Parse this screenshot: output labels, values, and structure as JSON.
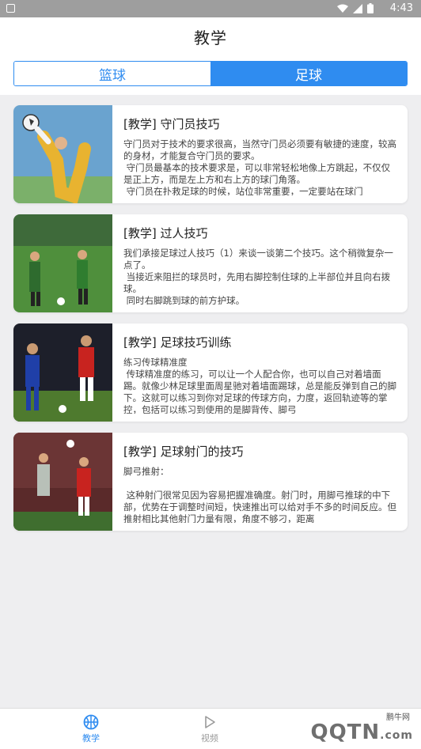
{
  "status_bar": {
    "time": "4:43"
  },
  "header": {
    "title": "教学"
  },
  "tabs": [
    {
      "label": "篮球",
      "active": false
    },
    {
      "label": "足球",
      "active": true
    }
  ],
  "articles": [
    {
      "title": "[教学] 守门员技巧",
      "body": "守门员对于技术的要求很高，当然守门员必须要有敏捷的速度，较高的身材，才能复合守门员的要求。\n 守门员最基本的技术要求是，可以非常轻松地像上方跳起，不仅仅是正上方，而是左上方和右上方的球门角落。\n 守门员在扑救足球的时候，站位非常重要，一定要站在球门",
      "thumb_icon": "goalkeeper-photo"
    },
    {
      "title": "[教学] 过人技巧",
      "body": "我们承接足球过人技巧（1）来谈一谈第二个技巧。这个稍微复杂一点了。\n 当接近来阻拦的球员时，先用右脚控制住球的上半部位并且向右拨球。\n 同时右脚跳到球的前方护球。",
      "thumb_icon": "dribbling-photo"
    },
    {
      "title": "[教学] 足球技巧训练",
      "body": "练习传球精准度\n 传球精准度的练习，可以让一个人配合你，也可以自己对着墙面踢。就像少林足球里面周星驰对着墙面踢球，总是能反弹到自己的脚下。这就可以练习到你对足球的传球方向，力度，返回轨迹等的掌控，包括可以练习到使用的是脚背传、脚弓",
      "thumb_icon": "training-photo"
    },
    {
      "title": "[教学] 足球射门的技巧",
      "body": "脚弓推射：\n\n 这种射门很常见因为容易把握准确度。射门时，用脚弓推球的中下部，优势在于调整时间短，快速推出可以给对手不多的时间反应。但推射相比其他射门力量有限，角度不够刁，距离",
      "thumb_icon": "shooting-photo"
    }
  ],
  "bottom_nav": [
    {
      "label": "教学",
      "icon": "basketball-icon",
      "active": true
    },
    {
      "label": "视频",
      "icon": "play-icon",
      "active": false
    }
  ],
  "watermark": {
    "small": "鹏牛网",
    "big": "QQTN",
    "suffix": ".com"
  },
  "colors": {
    "accent": "#2f8cf0",
    "background": "#eeeef0",
    "statusbar": "#9e9e9e"
  }
}
